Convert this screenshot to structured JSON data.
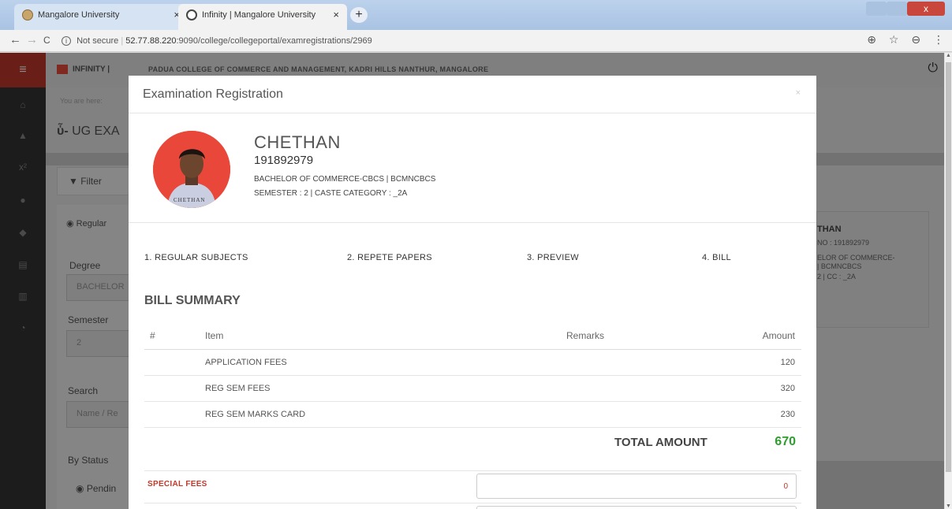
{
  "browser": {
    "tabs": [
      {
        "label": "Mangalore University",
        "close": "×"
      },
      {
        "label": "Infinity  |  Mangalore University",
        "close": "×"
      }
    ],
    "new_tab": "+",
    "window_close": "x",
    "nav": {
      "back": "←",
      "forward": "→",
      "reload": "C"
    },
    "url_security": "Not secure",
    "url_host": "52.77.88.220",
    "url_path": ":9090/college/collegeportal/examregistrations/2969",
    "right_icons": {
      "zoom": "⊕",
      "bookmark": "☆",
      "profile": "⊖",
      "menu": "⋮"
    }
  },
  "app": {
    "menu_icon": "≡",
    "brand": "INFINITY  |",
    "college_name": "PADUA COLLEGE OF COMMERCE AND MANAGEMENT, KADRI HILLS NANTHUR, MANGALORE",
    "power_icon": "⏻"
  },
  "background": {
    "breadcrumb": "You are here:",
    "page_title": "UG EXA",
    "filter_label": "Filter",
    "regular_radio": "Regular",
    "degree_label": "Degree",
    "degree_value": "BACHELOR",
    "semester_label": "Semester",
    "semester_value": "2",
    "search_label": "Search",
    "search_placeholder": "Name / Re",
    "by_status_label": "By Status",
    "pending_option": "Pendin",
    "right_card": {
      "name": "THAN",
      "reg_no": "NO : 191892979",
      "course_1": "ELOR OF COMMERCE-",
      "course_2": "| BCMNCBCS",
      "semcc": "2 | CC : _2A"
    }
  },
  "modal": {
    "title": "Examination Registration",
    "close": "×",
    "student": {
      "name": "CHETHAN",
      "id": "191892979",
      "course": "BACHELOR OF COMMERCE-CBCS | BCMNCBCS",
      "semester_line": "SEMESTER : 2  |  CASTE CATEGORY : _2A",
      "photo_caption": "CHETHAN"
    },
    "steps": [
      {
        "label": "1. REGULAR SUBJECTS"
      },
      {
        "label": "2. REPETE PAPERS"
      },
      {
        "label": "3. PREVIEW"
      },
      {
        "label": "4. BILL"
      }
    ],
    "bill": {
      "heading": "BILL SUMMARY",
      "columns": {
        "num": "#",
        "item": "Item",
        "remarks": "Remarks",
        "amount": "Amount"
      },
      "rows": [
        {
          "num": "",
          "item": "APPLICATION FEES",
          "remarks": "",
          "amount": "120"
        },
        {
          "num": "",
          "item": "REG SEM FEES",
          "remarks": "",
          "amount": "320"
        },
        {
          "num": "",
          "item": "REG SEM MARKS CARD",
          "remarks": "",
          "amount": "230"
        }
      ],
      "total_label": "TOTAL AMOUNT",
      "total_value": "670",
      "special_fees_label": "SPECIAL FEES",
      "special_fees_value": "0"
    }
  },
  "colors": {
    "accent_red": "#c0392b",
    "total_green": "#2e9e2e"
  }
}
